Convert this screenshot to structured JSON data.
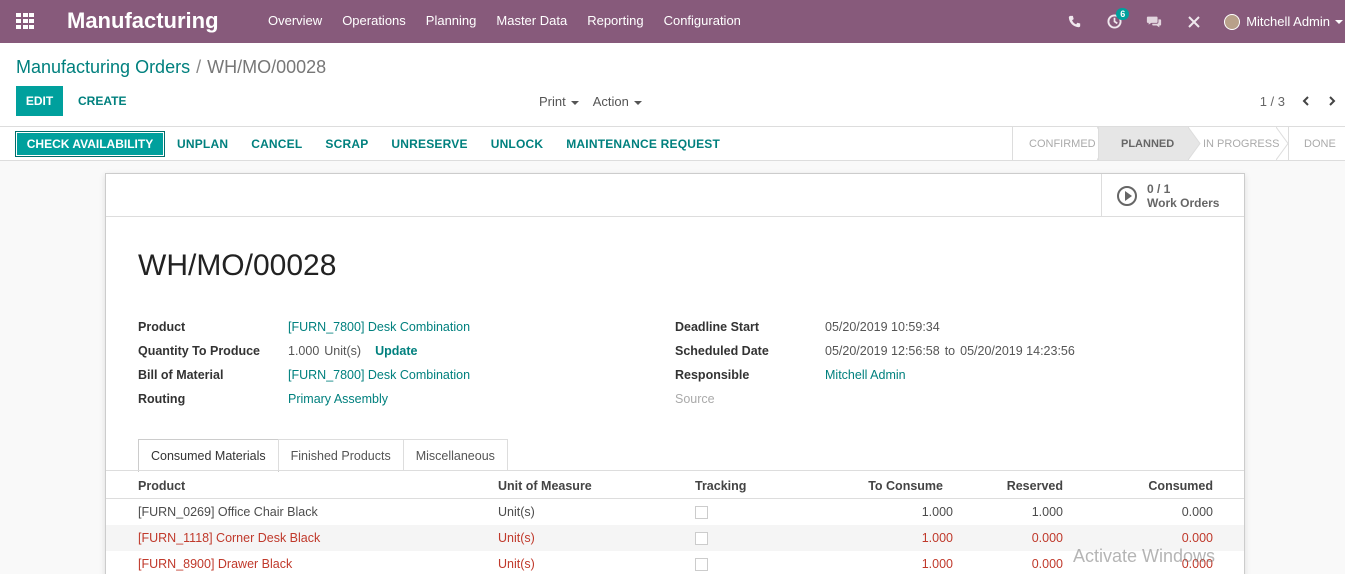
{
  "navbar": {
    "app_name": "Manufacturing",
    "menu": [
      "Overview",
      "Operations",
      "Planning",
      "Master Data",
      "Reporting",
      "Configuration"
    ],
    "activity_count": "6",
    "user_name": "Mitchell Admin"
  },
  "control": {
    "breadcrumb_parent": "Manufacturing Orders",
    "breadcrumb_separator": "/",
    "breadcrumb_current": "WH/MO/00028",
    "edit_label": "EDIT",
    "create_label": "CREATE",
    "print_label": "Print",
    "action_label": "Action",
    "pager": "1 / 3"
  },
  "statusbar": {
    "check_label": "CHECK AVAILABILITY",
    "actions": [
      "UNPLAN",
      "CANCEL",
      "SCRAP",
      "UNRESERVE",
      "UNLOCK",
      "MAINTENANCE REQUEST"
    ],
    "stages": [
      "CONFIRMED",
      "PLANNED",
      "IN PROGRESS",
      "DONE"
    ],
    "active_stage": "PLANNED"
  },
  "form": {
    "work_orders_count": "0 / 1",
    "work_orders_label": "Work Orders",
    "title": "WH/MO/00028",
    "left": {
      "product_label": "Product",
      "product_value": "[FURN_7800] Desk Combination",
      "qty_label": "Quantity To Produce",
      "qty_value": "1.000",
      "qty_uom": "Unit(s)",
      "update_label": "Update",
      "bom_label": "Bill of Material",
      "bom_value": "[FURN_7800] Desk Combination",
      "routing_label": "Routing",
      "routing_value": "Primary Assembly"
    },
    "right": {
      "deadline_label": "Deadline Start",
      "deadline_value": "05/20/2019 10:59:34",
      "scheduled_label": "Scheduled Date",
      "scheduled_from": "05/20/2019 12:56:58",
      "scheduled_to_word": "to",
      "scheduled_to": "05/20/2019 14:23:56",
      "responsible_label": "Responsible",
      "responsible_value": "Mitchell Admin",
      "source_label": "Source"
    },
    "tabs": [
      "Consumed Materials",
      "Finished Products",
      "Miscellaneous"
    ],
    "table": {
      "headers": [
        "Product",
        "Unit of Measure",
        "Tracking",
        "To Consume",
        "Reserved",
        "Consumed"
      ],
      "rows": [
        {
          "product": "[FURN_0269] Office Chair Black",
          "uom": "Unit(s)",
          "to_consume": "1.000",
          "reserved": "1.000",
          "consumed": "0.000"
        },
        {
          "product": "[FURN_1118] Corner Desk Black",
          "uom": "Unit(s)",
          "to_consume": "1.000",
          "reserved": "0.000",
          "consumed": "0.000"
        },
        {
          "product": "[FURN_8900] Drawer Black",
          "uom": "Unit(s)",
          "to_consume": "1.000",
          "reserved": "0.000",
          "consumed": "0.000"
        }
      ]
    }
  },
  "watermark": "Activate Windows",
  "colors": {
    "navbar": "#875a7b",
    "primary": "#00a09d",
    "link": "#00807e",
    "shortage": "#c0392b"
  }
}
